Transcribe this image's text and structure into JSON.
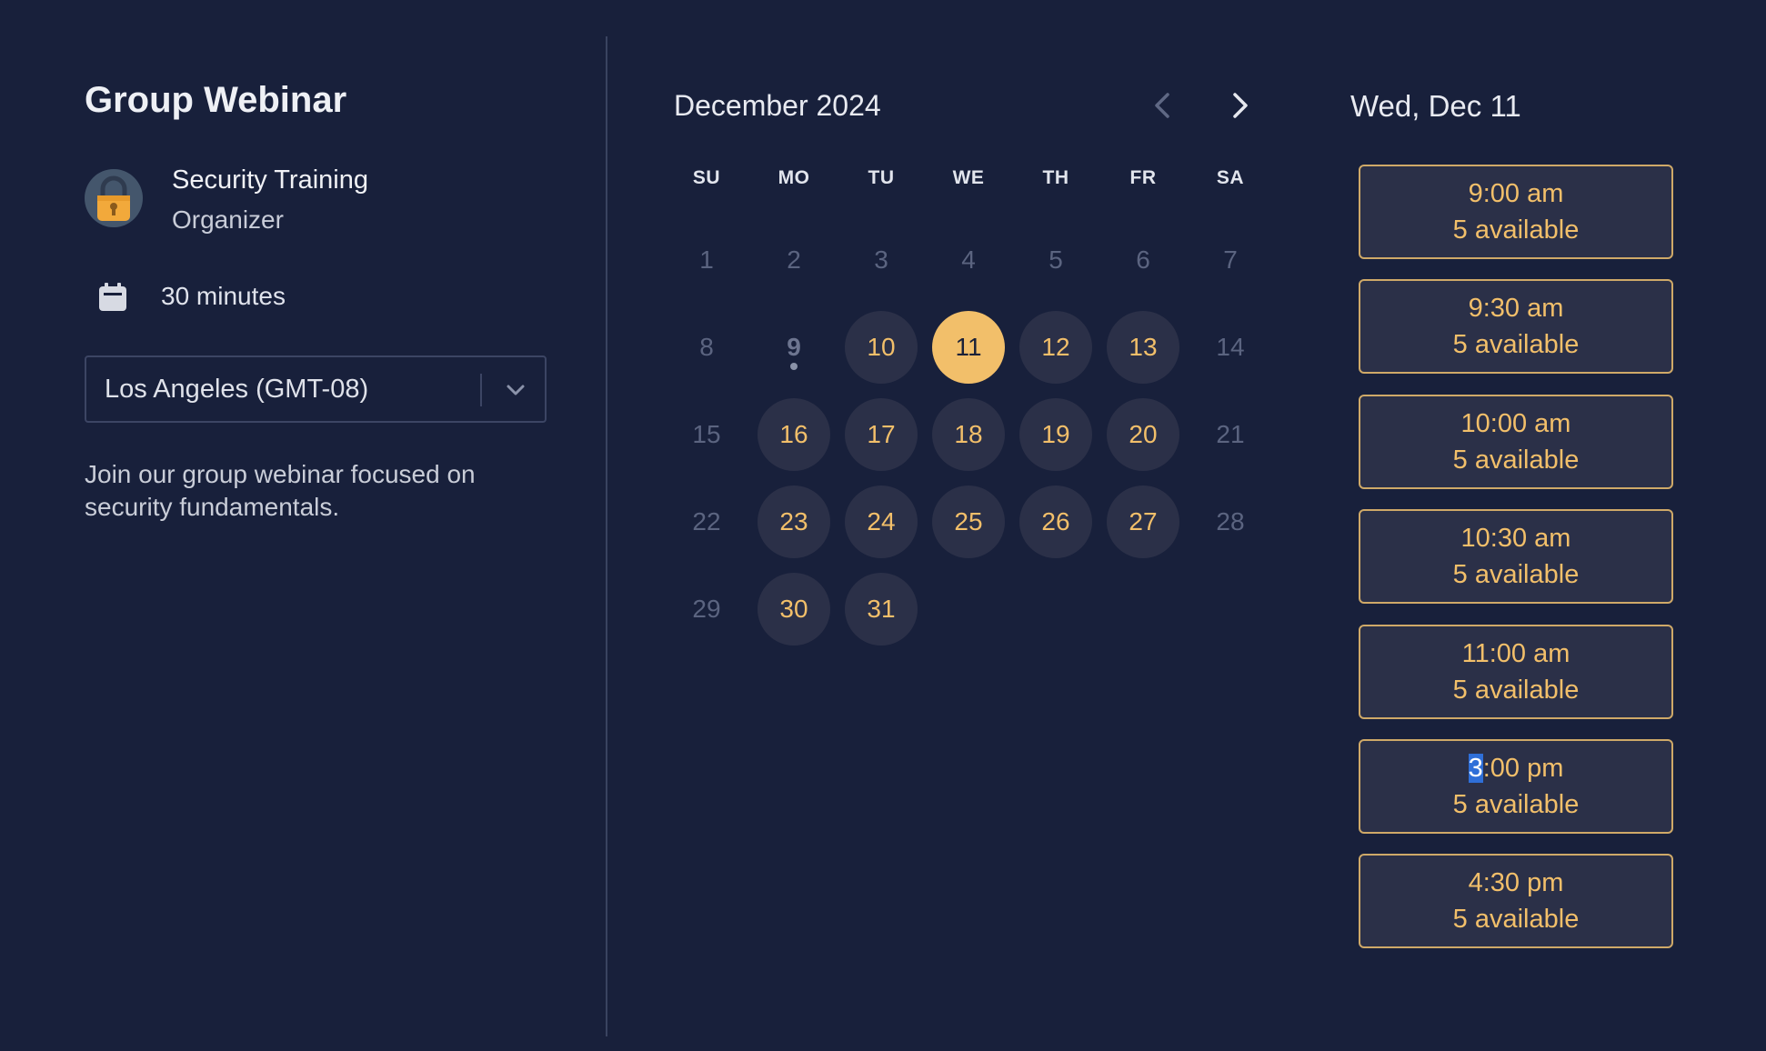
{
  "event": {
    "title": "Group Webinar",
    "organizer_name": "Security Training",
    "organizer_role": "Organizer",
    "duration": "30 minutes",
    "timezone": "Los Angeles (GMT-08)",
    "description": "Join our group webinar focused on security fundamentals.",
    "avatar_icon": "padlock-icon",
    "duration_icon": "calendar-icon"
  },
  "calendar": {
    "month_label": "December 2024",
    "prev_icon": "chevron-left-icon",
    "next_icon": "chevron-right-icon",
    "weekdays": [
      "SU",
      "MO",
      "TU",
      "WE",
      "TH",
      "FR",
      "SA"
    ],
    "days": [
      {
        "day": "1",
        "status": "disabled"
      },
      {
        "day": "2",
        "status": "disabled"
      },
      {
        "day": "3",
        "status": "disabled"
      },
      {
        "day": "4",
        "status": "disabled"
      },
      {
        "day": "5",
        "status": "disabled"
      },
      {
        "day": "6",
        "status": "disabled"
      },
      {
        "day": "7",
        "status": "disabled"
      },
      {
        "day": "8",
        "status": "disabled"
      },
      {
        "day": "9",
        "status": "today"
      },
      {
        "day": "10",
        "status": "available"
      },
      {
        "day": "11",
        "status": "selected"
      },
      {
        "day": "12",
        "status": "available"
      },
      {
        "day": "13",
        "status": "available"
      },
      {
        "day": "14",
        "status": "disabled"
      },
      {
        "day": "15",
        "status": "disabled"
      },
      {
        "day": "16",
        "status": "available"
      },
      {
        "day": "17",
        "status": "available"
      },
      {
        "day": "18",
        "status": "available"
      },
      {
        "day": "19",
        "status": "available"
      },
      {
        "day": "20",
        "status": "available"
      },
      {
        "day": "21",
        "status": "disabled"
      },
      {
        "day": "22",
        "status": "disabled"
      },
      {
        "day": "23",
        "status": "available"
      },
      {
        "day": "24",
        "status": "available"
      },
      {
        "day": "25",
        "status": "available"
      },
      {
        "day": "26",
        "status": "available"
      },
      {
        "day": "27",
        "status": "available"
      },
      {
        "day": "28",
        "status": "disabled"
      },
      {
        "day": "29",
        "status": "disabled"
      },
      {
        "day": "30",
        "status": "available"
      },
      {
        "day": "31",
        "status": "available"
      }
    ]
  },
  "slots": {
    "date_label": "Wed, Dec 11",
    "items": [
      {
        "time": "9:00 am",
        "availability": "5 available"
      },
      {
        "time": "9:30 am",
        "availability": "5 available"
      },
      {
        "time": "10:00 am",
        "availability": "5 available"
      },
      {
        "time": "10:30 am",
        "availability": "5 available"
      },
      {
        "time": "11:00 am",
        "availability": "5 available"
      },
      {
        "time_highlight": "3",
        "time_rest": ":00 pm",
        "availability": "5 available"
      },
      {
        "time": "4:30 pm",
        "availability": "5 available"
      }
    ]
  },
  "colors": {
    "background": "#18203b",
    "accent": "#f2bf6a",
    "available_day_bg": "#2b3048",
    "selection_highlight": "#2f6fd8"
  }
}
